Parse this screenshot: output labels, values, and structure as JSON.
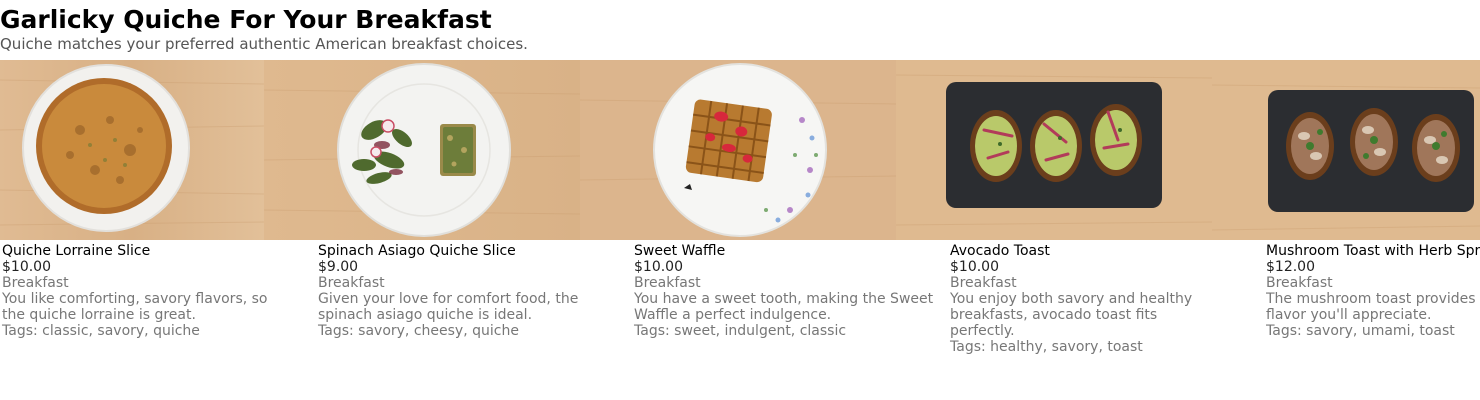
{
  "header": {
    "title": "Garlicky Quiche For Your Breakfast",
    "subtitle": "Quiche matches your preferred authentic American breakfast choices."
  },
  "items": [
    {
      "name": "Quiche Lorraine Slice",
      "price": "$10.00",
      "category": "Breakfast",
      "description": "You like comforting, savory flavors, so the quiche lorraine is great.",
      "tags_label": "Tags:",
      "tags": "classic, savory, quiche"
    },
    {
      "name": "Spinach Asiago Quiche Slice",
      "price": "$9.00",
      "category": "Breakfast",
      "description": "Given your love for comfort food, the spinach asiago quiche is ideal.",
      "tags_label": "Tags:",
      "tags": "savory, cheesy, quiche"
    },
    {
      "name": "Sweet Waffle",
      "price": "$10.00",
      "category": "Breakfast",
      "description": "You have a sweet tooth, making the Sweet Waffle a perfect indulgence.",
      "tags_label": "Tags:",
      "tags": "sweet, indulgent, classic"
    },
    {
      "name": "Avocado Toast",
      "price": "$10.00",
      "category": "Breakfast",
      "description": "You enjoy both savory and healthy breakfasts, avocado toast fits perfectly.",
      "tags_label": "Tags:",
      "tags": "healthy, savory, toast"
    },
    {
      "name": "Mushroom Toast with Herb Spr",
      "price": "$12.00",
      "category": "Breakfast",
      "description": "The mushroom toast provides earthy flavor you'll appreciate.",
      "tags_label": "Tags:",
      "tags": "savory, umami, toast"
    }
  ],
  "colors": {
    "wood": "#dcb58d",
    "plate": "#f4f4f2",
    "slate": "#2b2d31",
    "quiche": "#c98a3c",
    "avocado": "#b9c96a"
  }
}
